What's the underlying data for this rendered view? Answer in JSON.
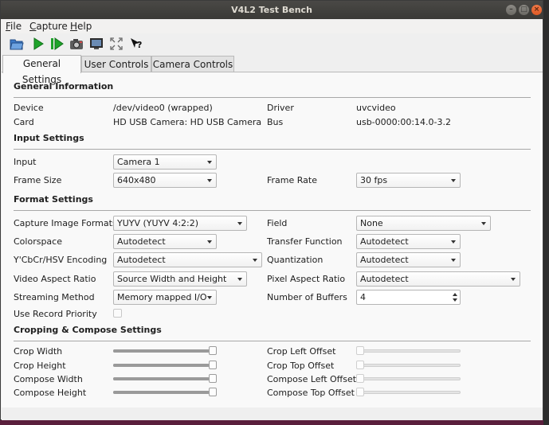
{
  "window": {
    "title": "V4L2 Test Bench"
  },
  "menu": [
    {
      "accel": "F",
      "rest": "ile"
    },
    {
      "accel": "C",
      "rest": "apture"
    },
    {
      "accel": "H",
      "rest": "elp"
    }
  ],
  "toolbar": {
    "icons": [
      "open-file-icon",
      "start-capture-icon",
      "step-capture-icon",
      "snapshot-camera-icon",
      "display-icon",
      "fullscreen-icon",
      "whats-this-help-icon"
    ]
  },
  "tabs": [
    "General Settings",
    "User Controls",
    "Camera Controls"
  ],
  "general": {
    "title": "General Information",
    "device_label": "Device",
    "device_value": "/dev/video0 (wrapped)",
    "driver_label": "Driver",
    "driver_value": "uvcvideo",
    "card_label": "Card",
    "card_value": "HD USB Camera: HD USB Camera",
    "bus_label": "Bus",
    "bus_value": "usb-0000:00:14.0-3.2"
  },
  "input": {
    "title": "Input Settings",
    "input_label": "Input",
    "input_value": "Camera 1",
    "frame_size_label": "Frame Size",
    "frame_size_value": "640x480",
    "frame_rate_label": "Frame Rate",
    "frame_rate_value": "30 fps"
  },
  "format": {
    "title": "Format Settings",
    "capture_formats_label": "Capture Image Formats",
    "capture_formats_value": "YUYV (YUYV 4:2:2)",
    "field_label": "Field",
    "field_value": "None",
    "colorspace_label": "Colorspace",
    "colorspace_value": "Autodetect",
    "transfer_label": "Transfer Function",
    "transfer_value": "Autodetect",
    "ycbcr_label": "Y'CbCr/HSV Encoding",
    "ycbcr_value": "Autodetect",
    "quantization_label": "Quantization",
    "quantization_value": "Autodetect",
    "aspect_label": "Video Aspect Ratio",
    "aspect_value": "Source Width and Height",
    "pixel_aspect_label": "Pixel Aspect Ratio",
    "pixel_aspect_value": "Autodetect",
    "streaming_label": "Streaming Method",
    "streaming_value": "Memory mapped I/O",
    "buffers_label": "Number of Buffers",
    "buffers_value": "4",
    "record_priority_label": "Use Record Priority",
    "record_priority_checked": false
  },
  "cropping": {
    "title": "Cropping & Compose Settings",
    "crop_width_label": "Crop Width",
    "crop_width_level": 1.0,
    "crop_height_label": "Crop Height",
    "crop_height_level": 1.0,
    "compose_width_label": "Compose Width",
    "compose_width_level": 1.0,
    "compose_height_label": "Compose Height",
    "compose_height_level": 1.0,
    "crop_left_label": "Crop Left Offset",
    "crop_left_level": 0.0,
    "crop_top_label": "Crop Top Offset",
    "crop_top_level": 0.0,
    "compose_left_label": "Compose Left Offset",
    "compose_left_level": 0.0,
    "compose_top_label": "Compose Top Offset",
    "compose_top_level": 0.0
  }
}
